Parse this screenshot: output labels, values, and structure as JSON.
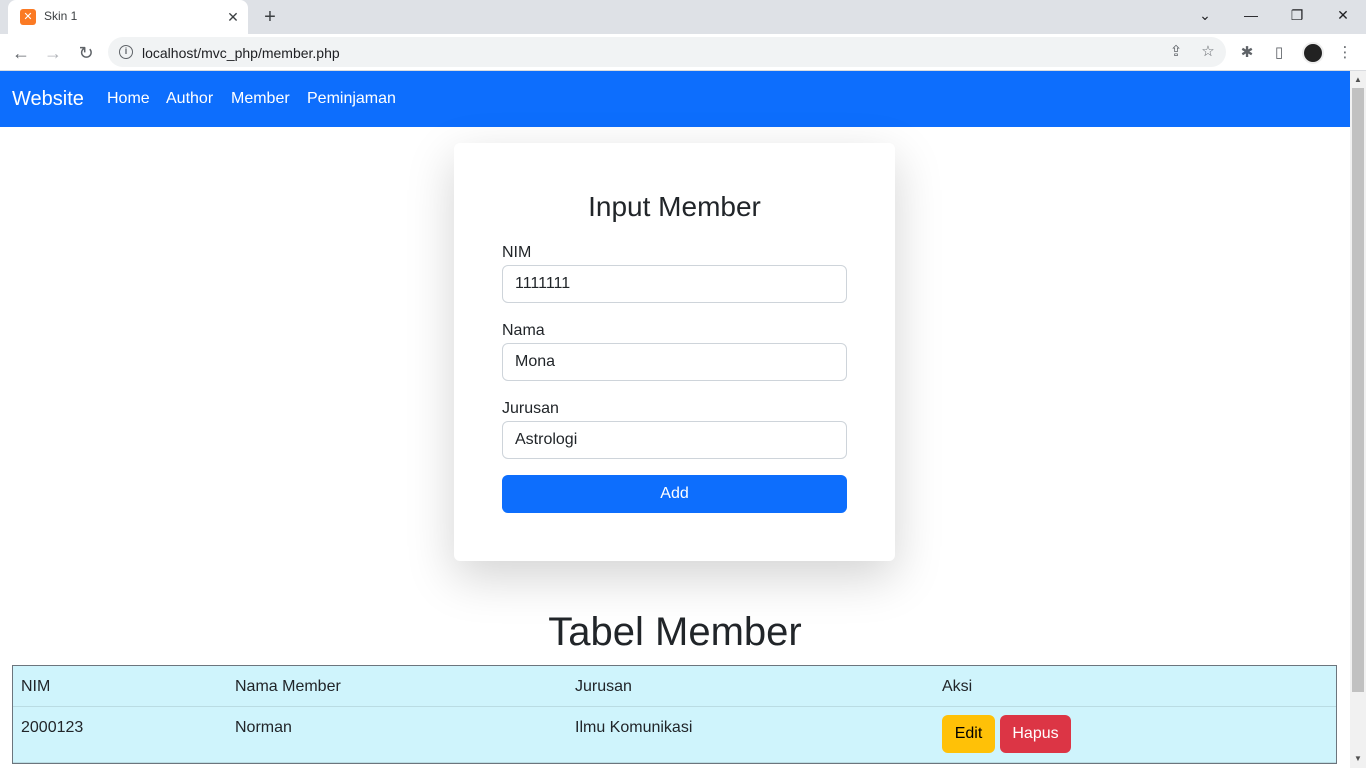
{
  "browser": {
    "tab_title": "Skin 1",
    "url": "localhost/mvc_php/member.php",
    "favicon_icon": "xampp-icon",
    "icons": {
      "close": "✕",
      "new_tab": "+",
      "back": "←",
      "forward": "→",
      "reload": "↻",
      "info": "i",
      "share": "⇪",
      "star": "☆",
      "extensions": "✱",
      "side_panel": "▯",
      "menu": "⋮",
      "tab_search": "⌄",
      "minimize": "—",
      "restore": "❐",
      "win_close": "✕",
      "scroll_up": "▲",
      "scroll_down": "▼"
    }
  },
  "navbar": {
    "brand": "Website",
    "links": [
      "Home",
      "Author",
      "Member",
      "Peminjaman"
    ],
    "color": "#0d6efd"
  },
  "form": {
    "title": "Input Member",
    "fields": [
      {
        "label": "NIM",
        "value": "1111111"
      },
      {
        "label": "Nama",
        "value": "Mona"
      },
      {
        "label": "Jurusan",
        "value": "Astrologi"
      }
    ],
    "submit_label": "Add"
  },
  "table": {
    "title": "Tabel Member",
    "headers": [
      "NIM",
      "Nama Member",
      "Jurusan",
      "Aksi"
    ],
    "rows": [
      {
        "nim": "2000123",
        "nama": "Norman",
        "jurusan": "Ilmu Komunikasi",
        "edit_label": "Edit",
        "delete_label": "Hapus"
      }
    ],
    "row_color": "#cff4fc"
  }
}
